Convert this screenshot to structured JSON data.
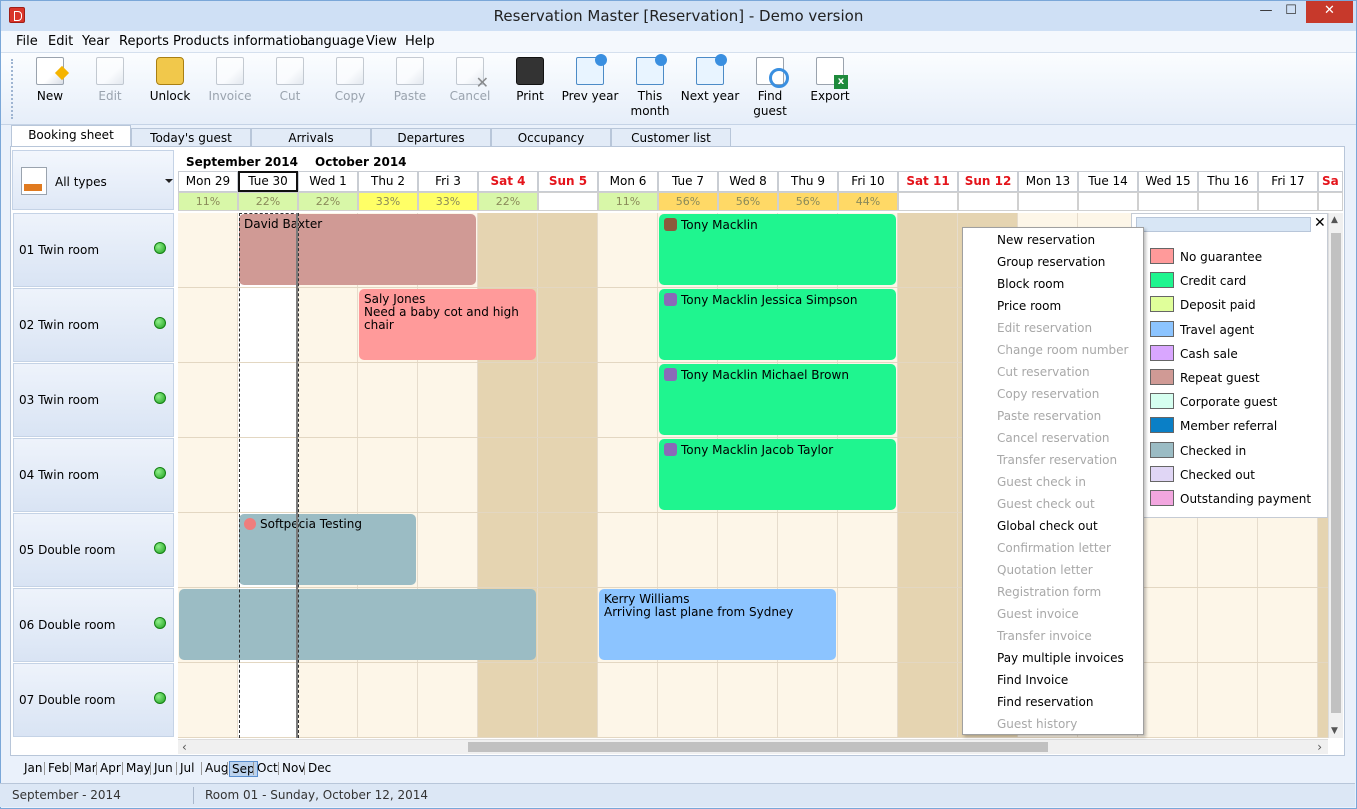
{
  "window": {
    "title": "Reservation Master [Reservation] - Demo version"
  },
  "menu": [
    "File",
    "Edit",
    "Year",
    "Reports",
    "Products information",
    "Language",
    "View",
    "Help"
  ],
  "toolbar": [
    {
      "label": "New",
      "icon": "new-document-icon",
      "enabled": true
    },
    {
      "label": "Edit",
      "icon": "edit-pencil-icon",
      "enabled": false
    },
    {
      "label": "Unlock",
      "icon": "padlock-icon",
      "enabled": true
    },
    {
      "label": "Invoice",
      "icon": "invoice-icon",
      "enabled": false
    },
    {
      "label": "Cut",
      "icon": "scissors-icon",
      "enabled": false
    },
    {
      "label": "Copy",
      "icon": "copy-icon",
      "enabled": false
    },
    {
      "label": "Paste",
      "icon": "clipboard-icon",
      "enabled": false
    },
    {
      "label": "Cancel",
      "icon": "cancel-x-icon",
      "enabled": false
    },
    {
      "label": "Print",
      "icon": "printer-icon",
      "enabled": true
    },
    {
      "label": "Prev year",
      "icon": "calendar-back-icon",
      "enabled": true
    },
    {
      "label": "This month",
      "icon": "calendar-down-icon",
      "enabled": true
    },
    {
      "label": "Next year",
      "icon": "calendar-forward-icon",
      "enabled": true
    },
    {
      "label": "Find guest",
      "icon": "magnifier-icon",
      "enabled": true
    },
    {
      "label": "Export",
      "icon": "excel-export-icon",
      "enabled": true
    }
  ],
  "tabs": [
    "Booking sheet",
    "Today's guest",
    "Arrivals",
    "Departures",
    "Occupancy",
    "Customer list"
  ],
  "active_tab": "Booking sheet",
  "type_selector": {
    "value": "All types"
  },
  "months_header": [
    "September 2014",
    "October 2014"
  ],
  "days": [
    {
      "label": "Mon 29",
      "weekend": false,
      "occ": "11%"
    },
    {
      "label": "Tue 30",
      "weekend": false,
      "occ": "22%",
      "today": true
    },
    {
      "label": "Wed 1",
      "weekend": false,
      "occ": "22%"
    },
    {
      "label": "Thu 2",
      "weekend": false,
      "occ": "33%"
    },
    {
      "label": "Fri 3",
      "weekend": false,
      "occ": "33%"
    },
    {
      "label": "Sat 4",
      "weekend": true,
      "occ": "22%"
    },
    {
      "label": "Sun 5",
      "weekend": true,
      "occ": ""
    },
    {
      "label": "Mon 6",
      "weekend": false,
      "occ": "11%"
    },
    {
      "label": "Tue 7",
      "weekend": false,
      "occ": "56%"
    },
    {
      "label": "Wed 8",
      "weekend": false,
      "occ": "56%"
    },
    {
      "label": "Thu 9",
      "weekend": false,
      "occ": "56%"
    },
    {
      "label": "Fri 10",
      "weekend": false,
      "occ": "44%"
    },
    {
      "label": "Sat 11",
      "weekend": true,
      "occ": ""
    },
    {
      "label": "Sun 12",
      "weekend": true,
      "occ": ""
    },
    {
      "label": "Mon 13",
      "weekend": false,
      "occ": ""
    },
    {
      "label": "Tue 14",
      "weekend": false,
      "occ": ""
    },
    {
      "label": "Wed 15",
      "weekend": false,
      "occ": ""
    },
    {
      "label": "Thu 16",
      "weekend": false,
      "occ": ""
    },
    {
      "label": "Fri 17",
      "weekend": false,
      "occ": ""
    },
    {
      "label": "Sa",
      "weekend": true,
      "occ": ""
    }
  ],
  "occ_colors": {
    "low": "#d8f7a8",
    "mid": "#ffff66",
    "high": "#ffd966"
  },
  "rooms": [
    {
      "label": "01  Twin room"
    },
    {
      "label": "02  Twin room"
    },
    {
      "label": "03  Twin room"
    },
    {
      "label": "04  Twin room"
    },
    {
      "label": "05  Double room"
    },
    {
      "label": "06  Double room"
    },
    {
      "label": "07  Double room"
    }
  ],
  "reservations": [
    {
      "room": 0,
      "start": 1,
      "span": 4,
      "lines": [
        "David Baxter"
      ],
      "color": "#d09a95",
      "icon": ""
    },
    {
      "room": 0,
      "start": 8,
      "span": 4,
      "lines": [
        "Tony Macklin"
      ],
      "color": "#1ff58f",
      "icon": "guest"
    },
    {
      "room": 1,
      "start": 3,
      "span": 3,
      "lines": [
        "Saly Jones",
        "Need a baby cot and high chair"
      ],
      "color": "#ff9a9a",
      "icon": ""
    },
    {
      "room": 1,
      "start": 8,
      "span": 4,
      "lines": [
        "Tony Macklin Jessica Simpson"
      ],
      "color": "#1ff58f",
      "icon": "group"
    },
    {
      "room": 2,
      "start": 8,
      "span": 4,
      "lines": [
        "Tony Macklin Michael Brown"
      ],
      "color": "#1ff58f",
      "icon": "group"
    },
    {
      "room": 3,
      "start": 8,
      "span": 4,
      "lines": [
        "Tony Macklin Jacob Taylor"
      ],
      "color": "#1ff58f",
      "icon": "group"
    },
    {
      "room": 4,
      "start": 1,
      "span": 3,
      "lines": [
        "Softpecia Testing"
      ],
      "color": "#9bbcc4",
      "icon": "dot"
    },
    {
      "room": 5,
      "start": 0,
      "span": 6,
      "lines": [],
      "color": "#9bbcc4",
      "icon": ""
    },
    {
      "room": 5,
      "start": 7,
      "span": 4,
      "lines": [
        "Kerry Williams",
        "Arriving last plane from Sydney"
      ],
      "color": "#8cc4ff",
      "icon": ""
    }
  ],
  "context_menu": [
    {
      "label": "New reservation",
      "enabled": true
    },
    {
      "label": "Group reservation",
      "enabled": true
    },
    {
      "label": "Block room",
      "enabled": true
    },
    {
      "label": "Price room",
      "enabled": true
    },
    {
      "label": "Edit reservation",
      "enabled": false
    },
    {
      "label": "Change room number",
      "enabled": false
    },
    {
      "label": "Cut reservation",
      "enabled": false
    },
    {
      "label": "Copy reservation",
      "enabled": false
    },
    {
      "label": "Paste reservation",
      "enabled": false
    },
    {
      "label": "Cancel reservation",
      "enabled": false
    },
    {
      "label": "Transfer reservation",
      "enabled": false
    },
    {
      "label": "Guest check in",
      "enabled": false
    },
    {
      "label": "Guest check out",
      "enabled": false
    },
    {
      "label": "Global check out",
      "enabled": true
    },
    {
      "label": "Confirmation letter",
      "enabled": false
    },
    {
      "label": "Quotation letter",
      "enabled": false
    },
    {
      "label": "Registration form",
      "enabled": false
    },
    {
      "label": "Guest invoice",
      "enabled": false
    },
    {
      "label": "Transfer invoice",
      "enabled": false
    },
    {
      "label": "Pay multiple invoices",
      "enabled": true
    },
    {
      "label": "Find Invoice",
      "enabled": true
    },
    {
      "label": "Find reservation",
      "enabled": true
    },
    {
      "label": "Guest history",
      "enabled": false
    }
  ],
  "legend": [
    {
      "label": "No guarantee",
      "color": "#ff9a9a"
    },
    {
      "label": "Credit card",
      "color": "#1ff58f"
    },
    {
      "label": "Deposit paid",
      "color": "#e0ff9a"
    },
    {
      "label": "Travel agent",
      "color": "#8cc4ff"
    },
    {
      "label": "Cash sale",
      "color": "#d9a6ff"
    },
    {
      "label": "Repeat guest",
      "color": "#d09a95"
    },
    {
      "label": "Corporate guest",
      "color": "#d6fff0"
    },
    {
      "label": "Member referral",
      "color": "#0a7fc6"
    },
    {
      "label": "Checked in",
      "color": "#9bbcc4"
    },
    {
      "label": "Checked out",
      "color": "#e0d6f5"
    },
    {
      "label": "Outstanding payment",
      "color": "#f2a6df"
    }
  ],
  "month_nav": [
    "Jan",
    "Feb",
    "Mar",
    "Apr",
    "May",
    "Jun",
    "Jul",
    "Aug",
    "Sep",
    "Oct",
    "Nov",
    "Dec"
  ],
  "month_nav_selected": "Sep",
  "status": {
    "left": "September - 2014",
    "right": "Room 01 - Sunday, October 12, 2014"
  }
}
